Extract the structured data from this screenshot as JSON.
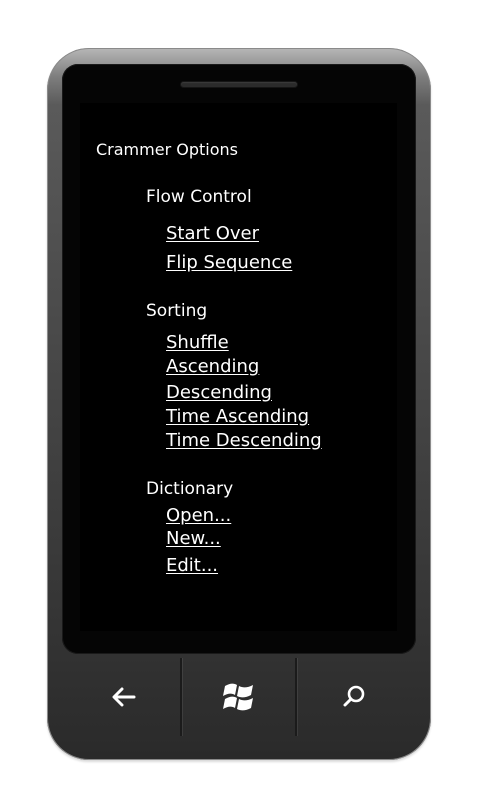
{
  "screen": {
    "title": "Crammer Options",
    "sections": [
      {
        "header": "Flow Control",
        "links": [
          "Start Over",
          "Flip Sequence"
        ]
      },
      {
        "header": "Sorting",
        "links": [
          "Shuffle",
          "Ascending",
          "Descending",
          "Time Ascending",
          "Time Descending"
        ]
      },
      {
        "header": "Dictionary",
        "links": [
          "Open...",
          "New...",
          "Edit..."
        ]
      }
    ]
  },
  "hardware_buttons": {
    "back_icon": "back-arrow-icon",
    "start_icon": "windows-logo-icon",
    "search_icon": "search-icon"
  },
  "colors": {
    "screen_background": "#000000",
    "text": "#FFFFFF",
    "device_body": "#3A3A3A"
  }
}
